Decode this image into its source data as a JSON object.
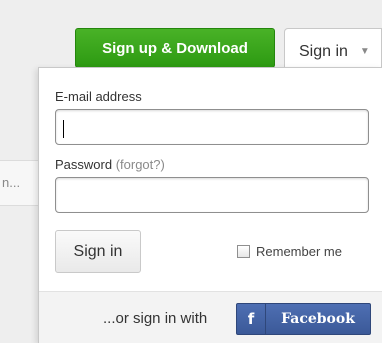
{
  "header": {
    "signup_label": "Sign up & Download",
    "signin_tab_label": "Sign in"
  },
  "background": {
    "partial_text": "n..."
  },
  "form": {
    "email_label": "E-mail address",
    "email_value": "",
    "password_label": "Password",
    "forgot_label": "(forgot?)",
    "password_value": "",
    "submit_label": "Sign in",
    "remember_label": "Remember me",
    "remember_checked": false
  },
  "footer": {
    "alt_signin_text": "...or sign in with",
    "facebook_icon_glyph": "f",
    "facebook_label": "Facebook"
  },
  "colors": {
    "signup_green": "#2d9a12",
    "facebook_blue": "#3b5998"
  }
}
